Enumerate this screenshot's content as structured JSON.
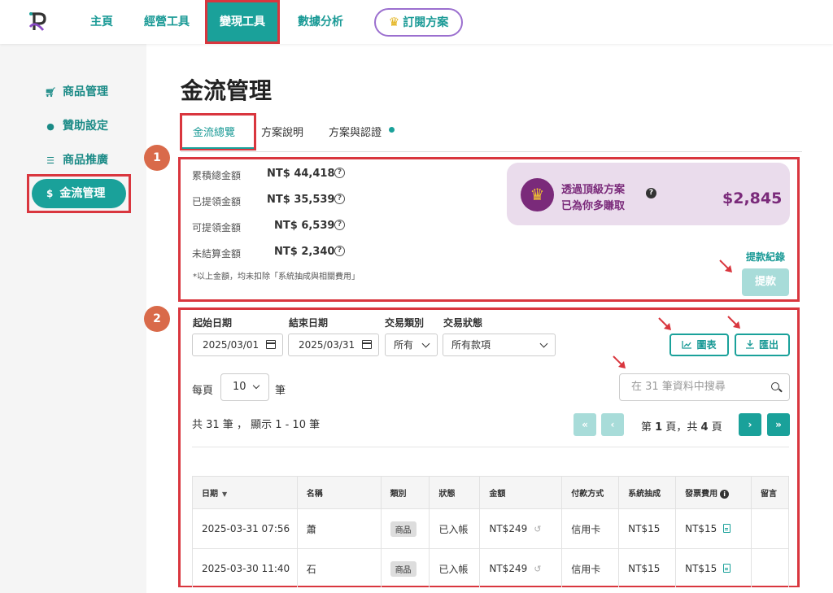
{
  "nav": {
    "items": [
      "主頁",
      "經營工具",
      "變現工具",
      "數據分析"
    ],
    "subscribe": "訂閱方案",
    "subscribe_icon": "crown-icon"
  },
  "sidebar": {
    "items": [
      {
        "label": "商品管理",
        "icon": "cart-icon"
      },
      {
        "label": "贊助設定",
        "icon": "coin-icon"
      },
      {
        "label": "商品推廣",
        "icon": "coins-stack-icon"
      },
      {
        "label": "金流管理",
        "icon": "dollar-icon"
      }
    ]
  },
  "page": {
    "title": "金流管理",
    "tabs": [
      "金流總覽",
      "方案說明",
      "方案與認證"
    ]
  },
  "markers": [
    "1",
    "2"
  ],
  "overview": {
    "stats": [
      {
        "label": "累積總金額",
        "value": "NT$ 44,418"
      },
      {
        "label": "已提領金額",
        "value": "NT$ 35,539"
      },
      {
        "label": "可提領金額",
        "value": "NT$ 6,539"
      },
      {
        "label": "未結算金額",
        "value": "NT$ 2,340"
      }
    ],
    "note": "*以上金額，均未扣除「系統抽成與相關費用」",
    "promo": {
      "line1": "透過頂級方案",
      "line2": "已為你多賺取",
      "amount": "$2,845"
    },
    "withdraw_log": "提款紀錄",
    "withdraw_button": "提款"
  },
  "filters": {
    "start_label": "起始日期",
    "end_label": "結束日期",
    "type_label": "交易類別",
    "status_label": "交易狀態",
    "start_value": "2025/03/01",
    "end_value": "2025/03/31",
    "type_value": "所有",
    "status_value": "所有款項",
    "chart_button": "圖表",
    "export_button": "匯出"
  },
  "listing": {
    "perpage_prefix": "每頁",
    "perpage_value": "10",
    "perpage_suffix": "筆",
    "search_placeholder": "在 31 筆資料中搜尋",
    "summary": "共 31 筆 ， 顯示 1 - 10 筆",
    "page_prefix": "第",
    "page_current": "1",
    "page_middle": "頁，共",
    "page_total": "4",
    "page_suffix": "頁"
  },
  "table": {
    "headers": [
      "日期",
      "名稱",
      "類別",
      "狀態",
      "金額",
      "付款方式",
      "系統抽成",
      "發票費用",
      "留言"
    ],
    "rows": [
      {
        "date": "2025-03-31 07:56",
        "name": "蕭",
        "type": "商品",
        "status": "已入帳",
        "amount": "NT$249",
        "payment": "信用卡",
        "fee": "NT$15",
        "invoice": "NT$15",
        "comment": ""
      },
      {
        "date": "2025-03-30 11:40",
        "name": "石",
        "type": "商品",
        "status": "已入帳",
        "amount": "NT$249",
        "payment": "信用卡",
        "fee": "NT$15",
        "invoice": "NT$15",
        "comment": ""
      }
    ]
  },
  "colors": {
    "primary": "#1aa19a",
    "highlight": "#d9363e",
    "promo_bg": "#eadcec",
    "promo_text": "#7a2a7a",
    "marker": "#d96a4a"
  }
}
